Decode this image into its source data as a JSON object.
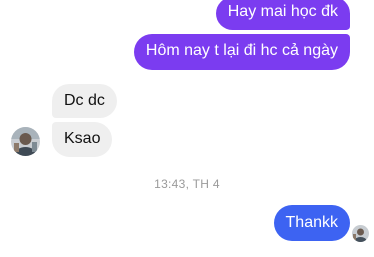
{
  "messages": {
    "out_1": "Hay mai học đk",
    "out_2": "Hôm nay t lại đi hc cả ngày",
    "in_1": "Dc dc",
    "in_2": "Ksao",
    "timestamp": "13:43, TH 4",
    "out_3": "Thankk"
  },
  "colors": {
    "outgoing_purple": "#7b3cf0",
    "outgoing_blue": "#3d63f2",
    "incoming_gray": "#efefef"
  },
  "icons": {
    "contact_avatar": "avatar-photo",
    "self_read_receipt": "avatar-photo"
  }
}
